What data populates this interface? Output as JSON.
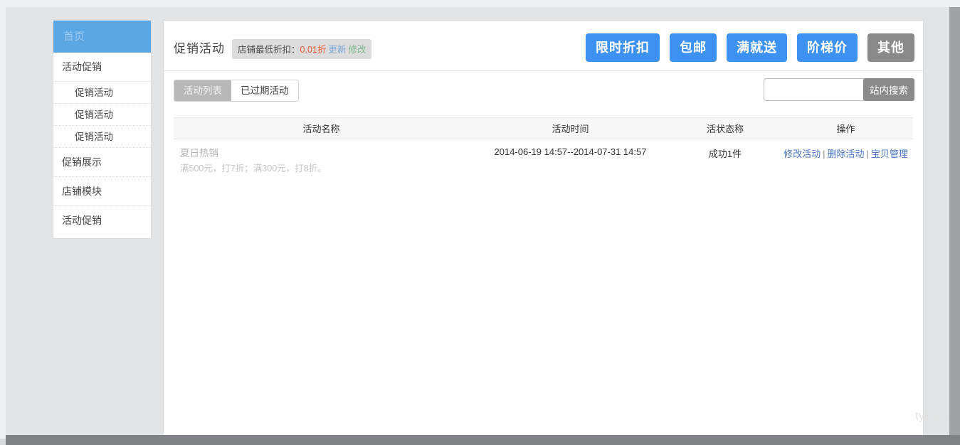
{
  "sidebar": {
    "items": [
      {
        "label": "首页",
        "level": "top",
        "active": true
      },
      {
        "label": "活动促销",
        "level": "top",
        "active": false
      },
      {
        "label": "促销活动",
        "level": "sub",
        "active": false
      },
      {
        "label": "促销活动",
        "level": "sub",
        "active": false
      },
      {
        "label": "促销活动",
        "level": "sub",
        "active": false
      },
      {
        "label": "促销展示",
        "level": "top",
        "active": false
      },
      {
        "label": "店铺模块",
        "level": "top",
        "active": false
      },
      {
        "label": "活动促销",
        "level": "top",
        "active": false
      }
    ]
  },
  "header": {
    "title": "促销活动",
    "badge": {
      "prefix": "店铺最低折扣：",
      "value": "0.01折",
      "update_label": "更新",
      "modify_label": "修改"
    },
    "buttons": [
      {
        "label": "限时折扣",
        "style": "blue"
      },
      {
        "label": "包邮",
        "style": "blue"
      },
      {
        "label": "满就送",
        "style": "blue"
      },
      {
        "label": "阶梯价",
        "style": "blue"
      },
      {
        "label": "其他",
        "style": "gray"
      }
    ]
  },
  "toolbar": {
    "tabs": [
      {
        "label": "活动列表",
        "active": true
      },
      {
        "label": "已过期活动",
        "active": false
      }
    ],
    "search": {
      "value": "",
      "placeholder": "",
      "button_label": "站内搜索"
    }
  },
  "table": {
    "columns": [
      "活动名称",
      "活动时间",
      "活状态称",
      "操作"
    ],
    "rows": [
      {
        "name": "夏日热销",
        "desc": "满500元，打7折；满300元，打8折。",
        "time": "2014-06-19 14:57--2014-07-31 14:57",
        "status": "成功1件",
        "ops": [
          "修改活动",
          "删除活动",
          "宝贝管理"
        ],
        "op_separator": "|"
      }
    ]
  },
  "watermark": "ty.com",
  "colors": {
    "accent_blue": "#3d91f0",
    "sidebar_active": "#5aa7e4",
    "gray_button": "#8a8a8a",
    "discount_value": "#f05b33",
    "link_update": "#7ba7d8",
    "link_modify": "#7fb98d",
    "table_link": "#4a73c4",
    "page_background": "#e2e4e6"
  }
}
